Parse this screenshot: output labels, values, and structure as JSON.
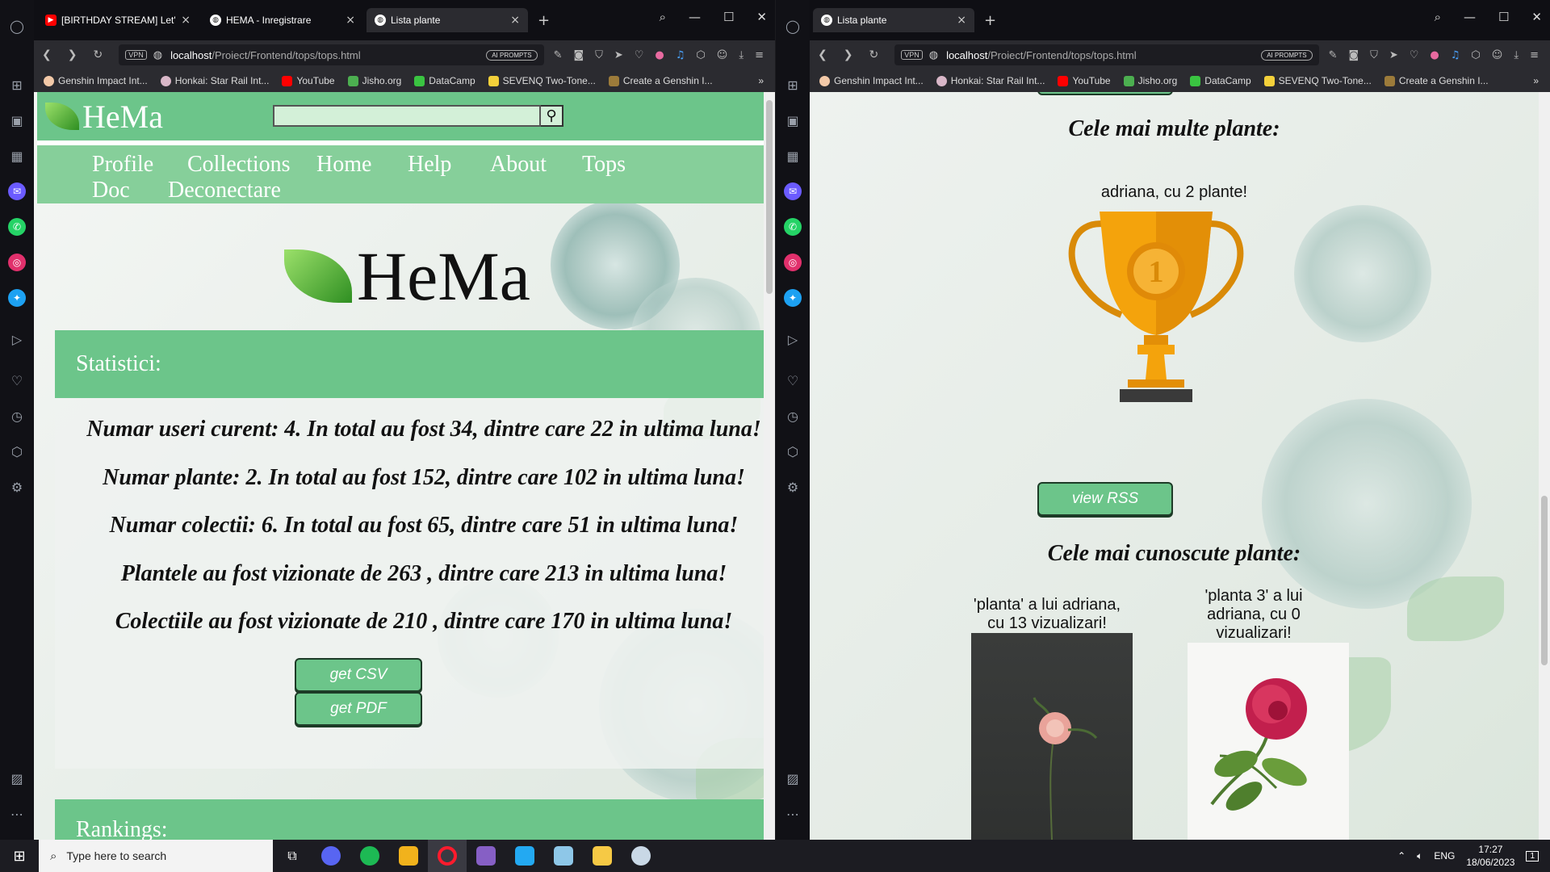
{
  "left_browser": {
    "tabs": [
      {
        "title": "[BIRTHDAY STREAM] Let's",
        "icon": "youtube-icon"
      },
      {
        "title": "HEMA - Inregistrare",
        "icon": "globe-icon"
      },
      {
        "title": "Lista plante",
        "icon": "globe-icon",
        "active": true
      }
    ],
    "url_host": "localhost",
    "url_path": "/Proiect/Frontend/tops/tops.html",
    "vpn_label": "VPN",
    "ai_prompts_label": "AI PROMPTS"
  },
  "right_browser": {
    "tabs": [
      {
        "title": "Lista plante",
        "icon": "globe-icon",
        "active": true
      }
    ],
    "url_host": "localhost",
    "url_path": "/Proiect/Frontend/tops/tops.html",
    "vpn_label": "VPN",
    "ai_prompts_label": "AI PROMPTS"
  },
  "bookmarks": [
    "Genshin Impact Int...",
    "Honkai: Star Rail Int...",
    "YouTube",
    "Jisho.org",
    "DataCamp",
    "SEVENQ Two-Tone...",
    "Create a Genshin I..."
  ],
  "site": {
    "brand": "HeMa",
    "search_placeholder": "",
    "menu": [
      "Profile",
      "Collections",
      "Home",
      "Help",
      "About",
      "Tops",
      "Doc",
      "Deconectare"
    ],
    "stats_title": "Statistici:",
    "stats_lines": [
      "Numar useri curent: 4. In total au fost 34, dintre care 22 in ultima luna!",
      "Numar plante: 2. In total au fost 152, dintre care 102 in ultima luna!",
      "Numar colectii: 6. In total au fost 65, dintre care 51 in ultima luna!",
      "Plantele au fost vizionate de 263 , dintre care 213 in ultima luna!",
      "Colectiile au fost vizionate de 210 , dintre care 170 in ultima luna!"
    ],
    "btn_csv": "get CSV",
    "btn_pdf": "get PDF",
    "rankings_title": "Rankings:",
    "most_plants_title": "Cele mai multe plante:",
    "most_plants_text": "adriana, cu 2 plante!",
    "trophy_number": "1",
    "btn_rss": "view RSS",
    "known_plants_title": "Cele mai cunoscute plante:",
    "known_plants": [
      {
        "caption": "'planta' a lui adriana, cu 13 vizualizari!"
      },
      {
        "caption": "'planta 3' a lui adriana, cu 0 vizualizari!"
      }
    ]
  },
  "taskbar": {
    "search_placeholder": "Type here to search",
    "lang": "ENG",
    "time": "17:27",
    "date": "18/06/2023",
    "notifications": "1"
  },
  "colors": {
    "site_green": "#6cc58a",
    "menu_green": "#86cf9a",
    "button_border": "#1d3b27",
    "trophy_gold": "#f4a30c"
  }
}
